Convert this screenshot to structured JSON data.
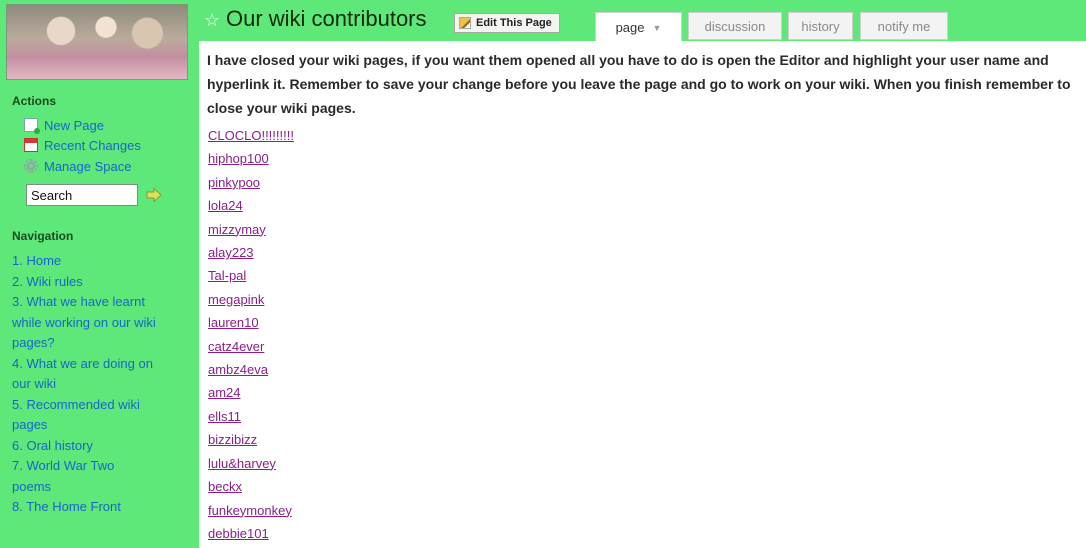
{
  "header": {
    "title": "Our wiki contributors",
    "edit_button": "Edit This Page",
    "tabs": [
      "page",
      "discussion",
      "history",
      "notify me"
    ]
  },
  "sidebar": {
    "actions_heading": "Actions",
    "actions": [
      {
        "label": "New Page",
        "icon": "new-page-icon"
      },
      {
        "label": "Recent Changes",
        "icon": "calendar-icon"
      },
      {
        "label": "Manage Space",
        "icon": "gear-icon"
      }
    ],
    "search_value": "Search",
    "navigation_heading": "Navigation",
    "navigation_lines": [
      "1. Home",
      "2. Wiki rules",
      "3. What we have learnt",
      "while working on our wiki",
      "pages?",
      "4. What we are doing on",
      "our wiki",
      "5. Recommended wiki",
      "pages",
      "6. Oral history",
      "7. World War Two",
      "poems",
      "8. The Home Front"
    ]
  },
  "content": {
    "intro": "I have closed your wiki pages, if you want them opened all you have to do is open the Editor and highlight your user name and hyperlink it. Remember to save your change before you leave the page and go to work on your wiki. When you finish remember to close your wiki pages.",
    "users": [
      "CLOCLO!!!!!!!!!",
      "hiphop100",
      "pinkypoo",
      "lola24",
      "mizzymay",
      "alay223",
      "Tal-pal",
      "megapink",
      "lauren10",
      "catz4ever",
      "ambz4eva",
      "am24",
      "ells11",
      "bizzibizz",
      "lulu&harvey",
      "beckx",
      "funkeymonkey",
      "debbie101"
    ]
  },
  "colors": {
    "sidebar_bg": "#5fe87a",
    "link_blue": "#1666c8",
    "link_visited": "#8a1e8a"
  }
}
